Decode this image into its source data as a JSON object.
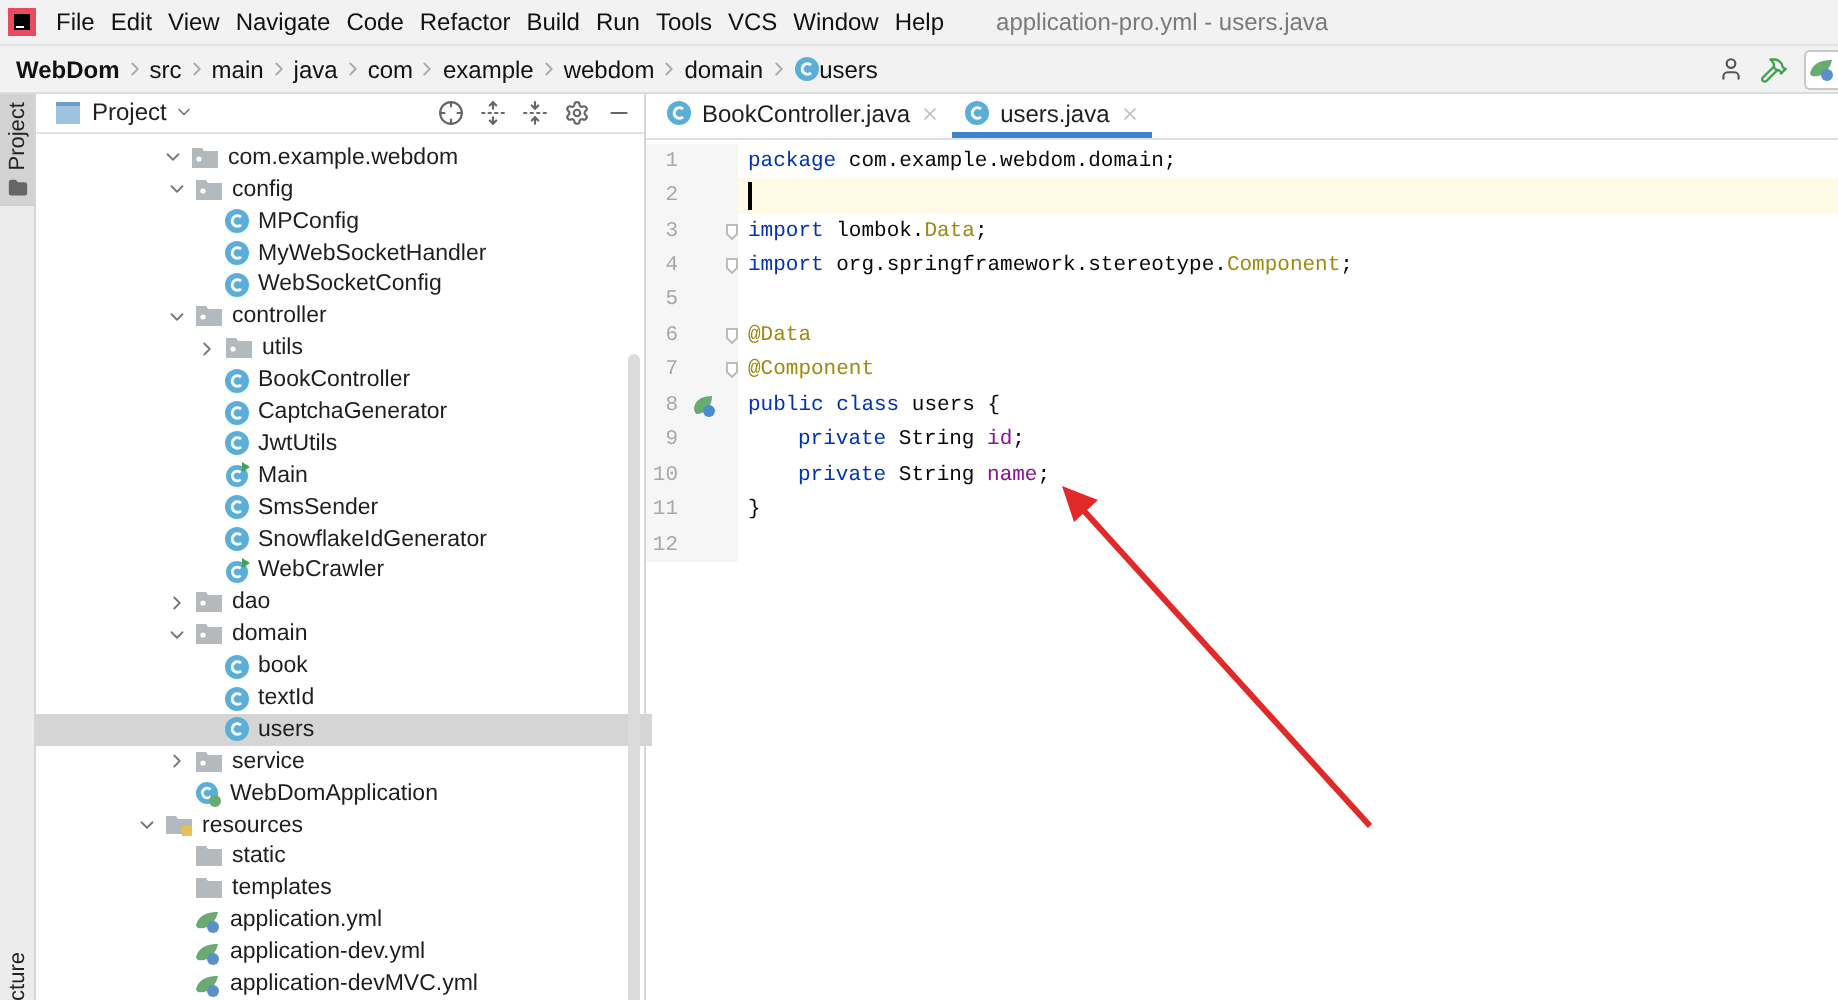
{
  "window": {
    "title": "application-pro.yml - users.java"
  },
  "menu": [
    "File",
    "Edit",
    "View",
    "Navigate",
    "Code",
    "Refactor",
    "Build",
    "Run",
    "Tools",
    "VCS",
    "Window",
    "Help"
  ],
  "breadcrumb": [
    {
      "label": "WebDom",
      "kind": "project"
    },
    {
      "label": "src",
      "kind": "folder"
    },
    {
      "label": "main",
      "kind": "folder"
    },
    {
      "label": "java",
      "kind": "folder"
    },
    {
      "label": "com",
      "kind": "folder"
    },
    {
      "label": "example",
      "kind": "folder"
    },
    {
      "label": "webdom",
      "kind": "folder"
    },
    {
      "label": "domain",
      "kind": "folder"
    },
    {
      "label": "users",
      "kind": "class"
    }
  ],
  "side_stripe": {
    "top": "Project",
    "bottom": "cture"
  },
  "project_panel": {
    "title": "Project",
    "tree": [
      {
        "label": "com.example.webdom",
        "kind": "package",
        "expanded": true,
        "selected": false,
        "children": [
          {
            "label": "config",
            "kind": "folder",
            "expanded": true,
            "selected": false,
            "children": [
              {
                "label": "MPConfig",
                "kind": "class",
                "selected": false
              },
              {
                "label": "MyWebSocketHandler",
                "kind": "class",
                "selected": false
              },
              {
                "label": "WebSocketConfig",
                "kind": "class",
                "selected": false
              }
            ]
          },
          {
            "label": "controller",
            "kind": "folder",
            "expanded": true,
            "selected": false,
            "children": [
              {
                "label": "utils",
                "kind": "folder",
                "expanded": false,
                "selected": false
              },
              {
                "label": "BookController",
                "kind": "class",
                "selected": false
              },
              {
                "label": "CaptchaGenerator",
                "kind": "class",
                "selected": false
              },
              {
                "label": "JwtUtils",
                "kind": "class",
                "selected": false
              },
              {
                "label": "Main",
                "kind": "runnable",
                "selected": false
              },
              {
                "label": "SmsSender",
                "kind": "class",
                "selected": false
              },
              {
                "label": "SnowflakeIdGenerator",
                "kind": "class",
                "selected": false
              },
              {
                "label": "WebCrawler",
                "kind": "runnable",
                "selected": false
              }
            ]
          },
          {
            "label": "dao",
            "kind": "folder",
            "expanded": false,
            "selected": false
          },
          {
            "label": "domain",
            "kind": "folder",
            "expanded": true,
            "selected": false,
            "children": [
              {
                "label": "book",
                "kind": "class",
                "selected": false
              },
              {
                "label": "textId",
                "kind": "class",
                "selected": false
              },
              {
                "label": "users",
                "kind": "class",
                "selected": true
              }
            ]
          },
          {
            "label": "service",
            "kind": "folder",
            "expanded": false,
            "selected": false
          },
          {
            "label": "WebDomApplication",
            "kind": "app",
            "selected": false
          }
        ]
      },
      {
        "label": "resources",
        "kind": "resources",
        "expanded": true,
        "selected": false,
        "children": [
          {
            "label": "static",
            "kind": "plain_folder",
            "selected": false
          },
          {
            "label": "templates",
            "kind": "plain_folder",
            "selected": false
          },
          {
            "label": "application.yml",
            "kind": "yml",
            "selected": false
          },
          {
            "label": "application-dev.yml",
            "kind": "yml",
            "selected": false
          },
          {
            "label": "application-devMVC.yml",
            "kind": "yml",
            "selected": false
          }
        ]
      }
    ]
  },
  "tabs": [
    {
      "label": "BookController.java",
      "selected": false
    },
    {
      "label": "users.java",
      "selected": true
    }
  ],
  "code": [
    {
      "number": "1",
      "current": false,
      "fold": false,
      "bean_marker": false,
      "indented": false,
      "tokens": [
        {
          "kind": "keyword",
          "text": "package"
        },
        {
          "kind": "plain",
          "text": " com.example.webdom.domain;"
        }
      ]
    },
    {
      "number": "2",
      "current": true,
      "fold": false,
      "bean_marker": false
    },
    {
      "number": "3",
      "current": false,
      "fold": true,
      "bean_marker": false,
      "indented": false,
      "tokens": [
        {
          "kind": "keyword",
          "text": "import"
        },
        {
          "kind": "plain",
          "text": " lombok."
        },
        {
          "kind": "annotation",
          "text": "Data"
        },
        {
          "kind": "plain",
          "text": ";"
        }
      ]
    },
    {
      "number": "4",
      "current": false,
      "fold": true,
      "bean_marker": false,
      "indented": false,
      "tokens": [
        {
          "kind": "keyword",
          "text": "import"
        },
        {
          "kind": "plain",
          "text": " org.springframework.stereotype."
        },
        {
          "kind": "annotation",
          "text": "Component"
        },
        {
          "kind": "plain",
          "text": ";"
        }
      ]
    },
    {
      "number": "5",
      "current": false,
      "fold": false,
      "bean_marker": false
    },
    {
      "number": "6",
      "current": false,
      "fold": true,
      "bean_marker": false,
      "indented": false,
      "tokens": [
        {
          "kind": "annotation",
          "text": "@Data"
        }
      ]
    },
    {
      "number": "7",
      "current": false,
      "fold": true,
      "bean_marker": false,
      "indented": false,
      "tokens": [
        {
          "kind": "annotation",
          "text": "@Component"
        }
      ]
    },
    {
      "number": "8",
      "current": false,
      "fold": false,
      "bean_marker": true,
      "indented": false,
      "tokens": [
        {
          "kind": "keyword",
          "text": "public class"
        },
        {
          "kind": "plain",
          "text": " users {"
        }
      ]
    },
    {
      "number": "9",
      "current": false,
      "fold": false,
      "bean_marker": false,
      "indented": true,
      "tokens": [
        {
          "kind": "keyword",
          "text": "private"
        },
        {
          "kind": "plain",
          "text": " String "
        },
        {
          "kind": "field",
          "text": "id"
        },
        {
          "kind": "plain",
          "text": ";"
        }
      ]
    },
    {
      "number": "10",
      "current": false,
      "fold": false,
      "bean_marker": false,
      "indented": true,
      "tokens": [
        {
          "kind": "keyword",
          "text": "private"
        },
        {
          "kind": "plain",
          "text": " String "
        },
        {
          "kind": "field",
          "text": "name"
        },
        {
          "kind": "plain",
          "text": ";"
        }
      ]
    },
    {
      "number": "11",
      "current": false,
      "fold": false,
      "bean_marker": false,
      "indented": false,
      "tokens": [
        {
          "kind": "plain",
          "text": "}"
        }
      ]
    },
    {
      "number": "12",
      "current": false,
      "fold": false,
      "bean_marker": false
    }
  ]
}
